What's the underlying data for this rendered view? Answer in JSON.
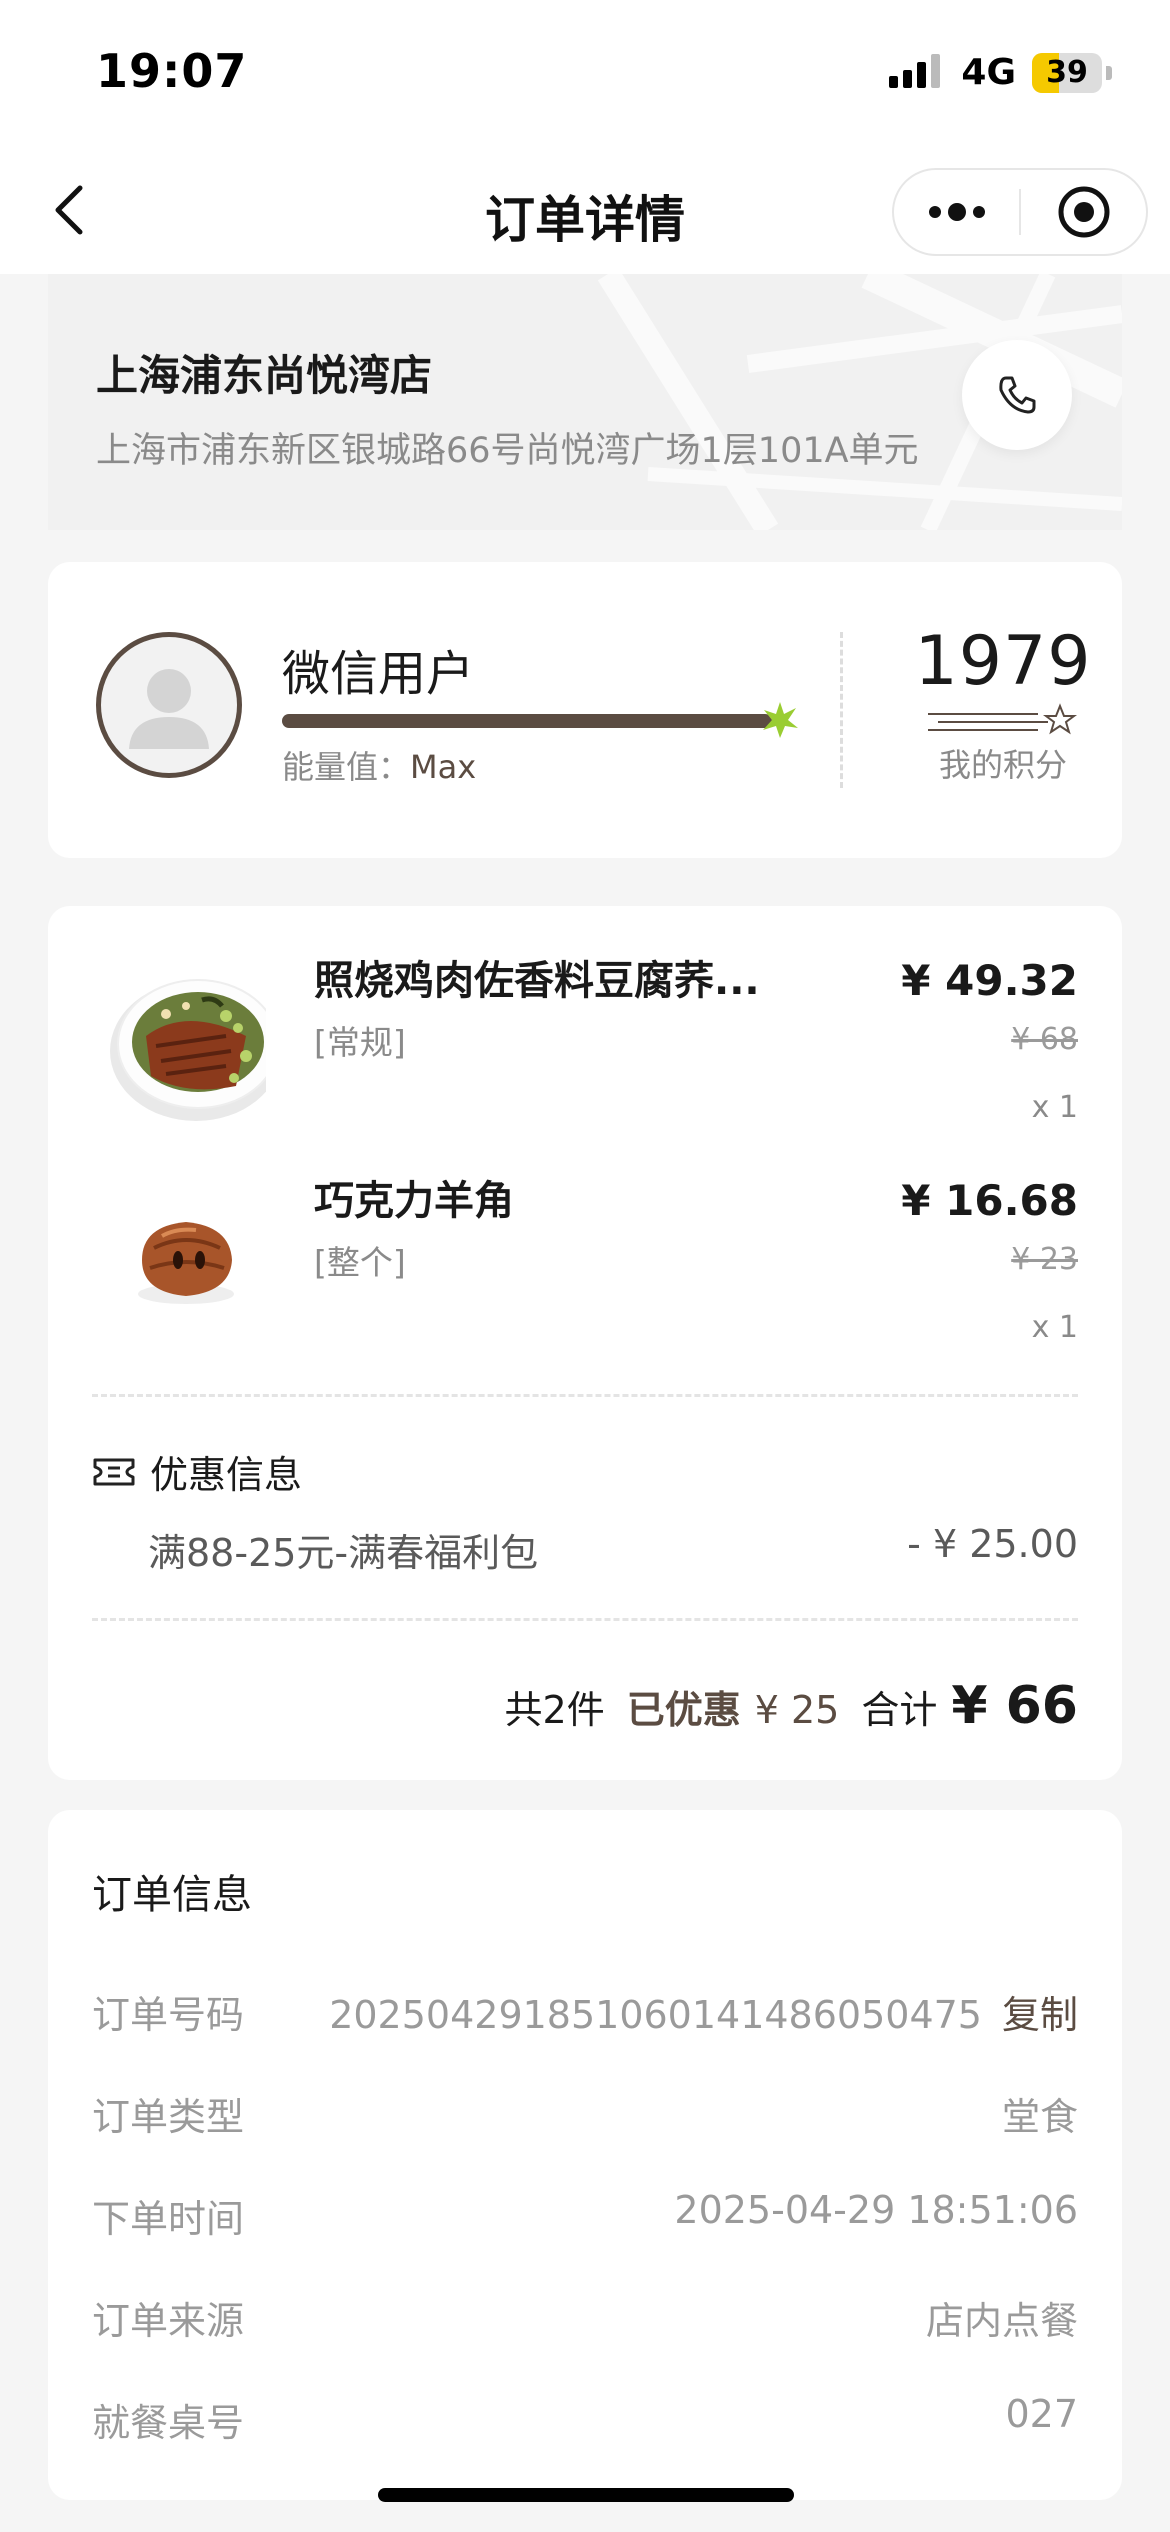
{
  "status_bar": {
    "time": "19:07",
    "network": "4G",
    "battery": "39",
    "battery_level_percent": 39
  },
  "nav": {
    "title": "订单详情",
    "back_icon": "chevron-left-icon",
    "more_icon": "more-dots-icon",
    "close_icon": "target-circle-icon"
  },
  "store": {
    "name": "上海浦东尚悦湾店",
    "address": "上海市浦东新区银城路66号尚悦湾广场1层101A单元",
    "phone_icon": "phone-icon"
  },
  "member": {
    "user_name": "微信用户",
    "energy_label": "能量值：",
    "energy_value": "Max",
    "energy_level_percent": 100,
    "points": "1979",
    "points_label": "我的积分"
  },
  "order_items": [
    {
      "name": "照烧鸡肉佐香料豆腐荞...",
      "spec": "[常规]",
      "price": "¥ 49.32",
      "original_price": "¥ 68",
      "quantity": "x 1",
      "image": "teriyaki-chicken-bowl-image"
    },
    {
      "name": "巧克力羊角",
      "spec": "[整个]",
      "price": "¥ 16.68",
      "original_price": "¥ 23",
      "quantity": "x 1",
      "image": "chocolate-croissant-image"
    }
  ],
  "promotion": {
    "title": "优惠信息",
    "name": "满88-25元-满春福利包",
    "amount": "- ¥ 25.00",
    "icon": "coupon-ticket-icon"
  },
  "summary": {
    "count": "共2件",
    "saved_label": "已优惠",
    "saved_amount": "¥ 25",
    "total_label": "合计",
    "total": "¥ 66"
  },
  "order_info": {
    "title": "订单信息",
    "rows": [
      {
        "label": "订单号码",
        "value": "2025042918510601414860504​75"
      },
      {
        "label": "订单类型",
        "value": "堂食"
      },
      {
        "label": "下单时间",
        "value": "2025-04-29 18:51:06"
      },
      {
        "label": "订单来源",
        "value": "店内点餐"
      },
      {
        "label": "就餐桌号",
        "value": "027"
      }
    ],
    "copy_label": "复制"
  },
  "colors": {
    "accent_brown": "#5b4c42",
    "energy_star": "#9acd32",
    "background": "#f5f5f5"
  }
}
